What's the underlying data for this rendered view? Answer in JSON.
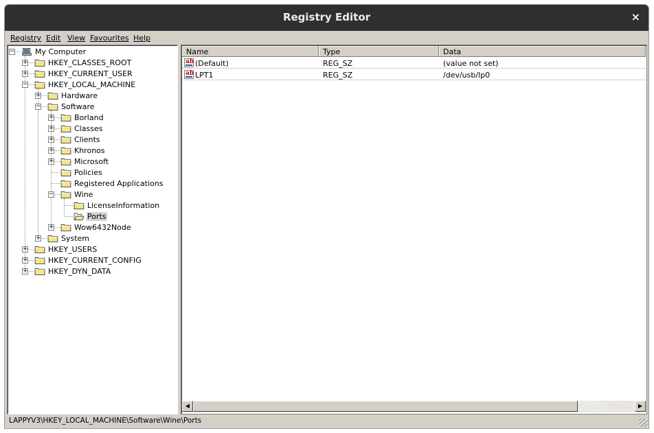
{
  "window": {
    "title": "Registry Editor",
    "close_glyph": "×"
  },
  "menu": [
    "Registry",
    "Edit",
    "View",
    "Favourites",
    "Help"
  ],
  "tree": [
    {
      "label": "My Computer",
      "level": 0,
      "expander": "-",
      "icon": "computer"
    },
    {
      "label": "HKEY_CLASSES_ROOT",
      "level": 1,
      "expander": "+"
    },
    {
      "label": "HKEY_CURRENT_USER",
      "level": 1,
      "expander": "+"
    },
    {
      "label": "HKEY_LOCAL_MACHINE",
      "level": 1,
      "expander": "-"
    },
    {
      "label": "Hardware",
      "level": 2,
      "expander": "+"
    },
    {
      "label": "Software",
      "level": 2,
      "expander": "-"
    },
    {
      "label": "Borland",
      "level": 3,
      "expander": "+"
    },
    {
      "label": "Classes",
      "level": 3,
      "expander": "+"
    },
    {
      "label": "Clients",
      "level": 3,
      "expander": "+"
    },
    {
      "label": "Khronos",
      "level": 3,
      "expander": "+"
    },
    {
      "label": "Microsoft",
      "level": 3,
      "expander": "+"
    },
    {
      "label": "Policies",
      "level": 3,
      "expander": ""
    },
    {
      "label": "Registered Applications",
      "level": 3,
      "expander": ""
    },
    {
      "label": "Wine",
      "level": 3,
      "expander": "-"
    },
    {
      "label": "LicenseInformation",
      "level": 4,
      "expander": ""
    },
    {
      "label": "Ports",
      "level": 4,
      "expander": "",
      "selected": true,
      "open": true
    },
    {
      "label": "Wow6432Node",
      "level": 3,
      "expander": "+"
    },
    {
      "label": "System",
      "level": 2,
      "expander": "+"
    },
    {
      "label": "HKEY_USERS",
      "level": 1,
      "expander": "+"
    },
    {
      "label": "HKEY_CURRENT_CONFIG",
      "level": 1,
      "expander": "+"
    },
    {
      "label": "HKEY_DYN_DATA",
      "level": 1,
      "expander": "+"
    }
  ],
  "list": {
    "columns": [
      "Name",
      "Type",
      "Data"
    ],
    "rows": [
      {
        "name": "(Default)",
        "type": "REG_SZ",
        "data": "(value not set)"
      },
      {
        "name": "LPT1",
        "type": "REG_SZ",
        "data": "/dev/usb/lp0"
      }
    ],
    "icon_text": "ab"
  },
  "scrollbar": {
    "left_glyph": "◀",
    "right_glyph": "▶"
  },
  "status": {
    "path": "LAPPYV3\\HKEY_LOCAL_MACHINE\\Software\\Wine\\Ports"
  },
  "colors": {
    "titlebar": "#2f2f2f",
    "chrome": "#d4d0c8",
    "folder": "#f4e48c"
  }
}
